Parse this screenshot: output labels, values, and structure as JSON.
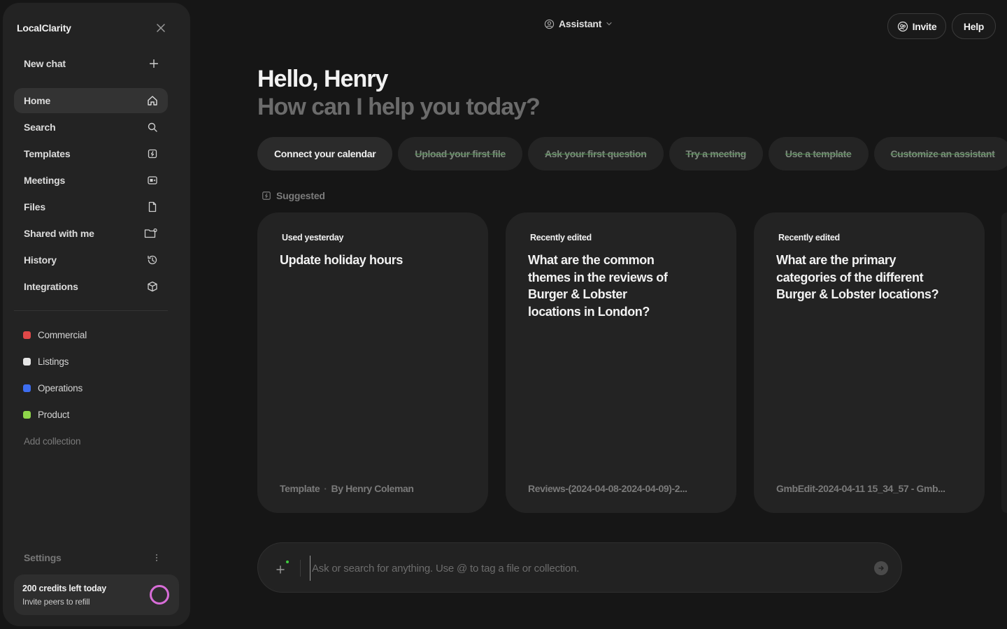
{
  "sidebar": {
    "brand": "LocalClarity",
    "new_chat": "New chat",
    "nav": [
      {
        "label": "Home",
        "icon": "home-icon",
        "active": true
      },
      {
        "label": "Search",
        "icon": "search-icon"
      },
      {
        "label": "Templates",
        "icon": "template-icon"
      },
      {
        "label": "Meetings",
        "icon": "video-icon"
      },
      {
        "label": "Files",
        "icon": "file-icon"
      },
      {
        "label": "Shared with me",
        "icon": "shared-folder-icon"
      },
      {
        "label": "History",
        "icon": "history-icon"
      },
      {
        "label": "Integrations",
        "icon": "cube-icon"
      }
    ],
    "collections": [
      {
        "label": "Commercial",
        "color": "#e04848"
      },
      {
        "label": "Listings",
        "color": "#e6e6e6"
      },
      {
        "label": "Operations",
        "color": "#3d6df0"
      },
      {
        "label": "Product",
        "color": "#8fd64a"
      }
    ],
    "add_collection": "Add collection",
    "settings": "Settings",
    "credits": {
      "title": "200 credits left today",
      "subtitle": "Invite peers to refill"
    }
  },
  "header": {
    "assistant": "Assistant",
    "invite": "Invite",
    "help": "Help"
  },
  "greeting": {
    "line1": "Hello, Henry",
    "line2": "How can I help you today?"
  },
  "chips": [
    {
      "label": "Connect your calendar",
      "done": false
    },
    {
      "label": "Upload your first file",
      "done": true
    },
    {
      "label": "Ask your first question",
      "done": true
    },
    {
      "label": "Try a meeting",
      "done": true
    },
    {
      "label": "Use a template",
      "done": true
    },
    {
      "label": "Customize an assistant",
      "done": true
    }
  ],
  "suggested_label": "Suggested",
  "cards": [
    {
      "badge": "Used yesterday",
      "title": "Update holiday hours",
      "foot_a": "Template",
      "foot_b": "By Henry Coleman"
    },
    {
      "badge": "Recently edited",
      "title": "What are the common themes in the reviews of Burger & Lobster locations in London?",
      "foot_a": "Reviews-(2024-04-08-2024-04-09)-2..."
    },
    {
      "badge": "Recently edited",
      "title": "What are the primary categories of the different Burger & Lobster locations?",
      "foot_a": "GmbEdit-2024-04-11 15_34_57 - Gmb..."
    }
  ],
  "composer": {
    "placeholder": "Ask or search for anything. Use @ to tag a file or collection."
  },
  "colors": {
    "accent_ring": "#d86dd8",
    "done_strike": "#4f8f4f",
    "spark_dot": "#3fcf3f"
  }
}
